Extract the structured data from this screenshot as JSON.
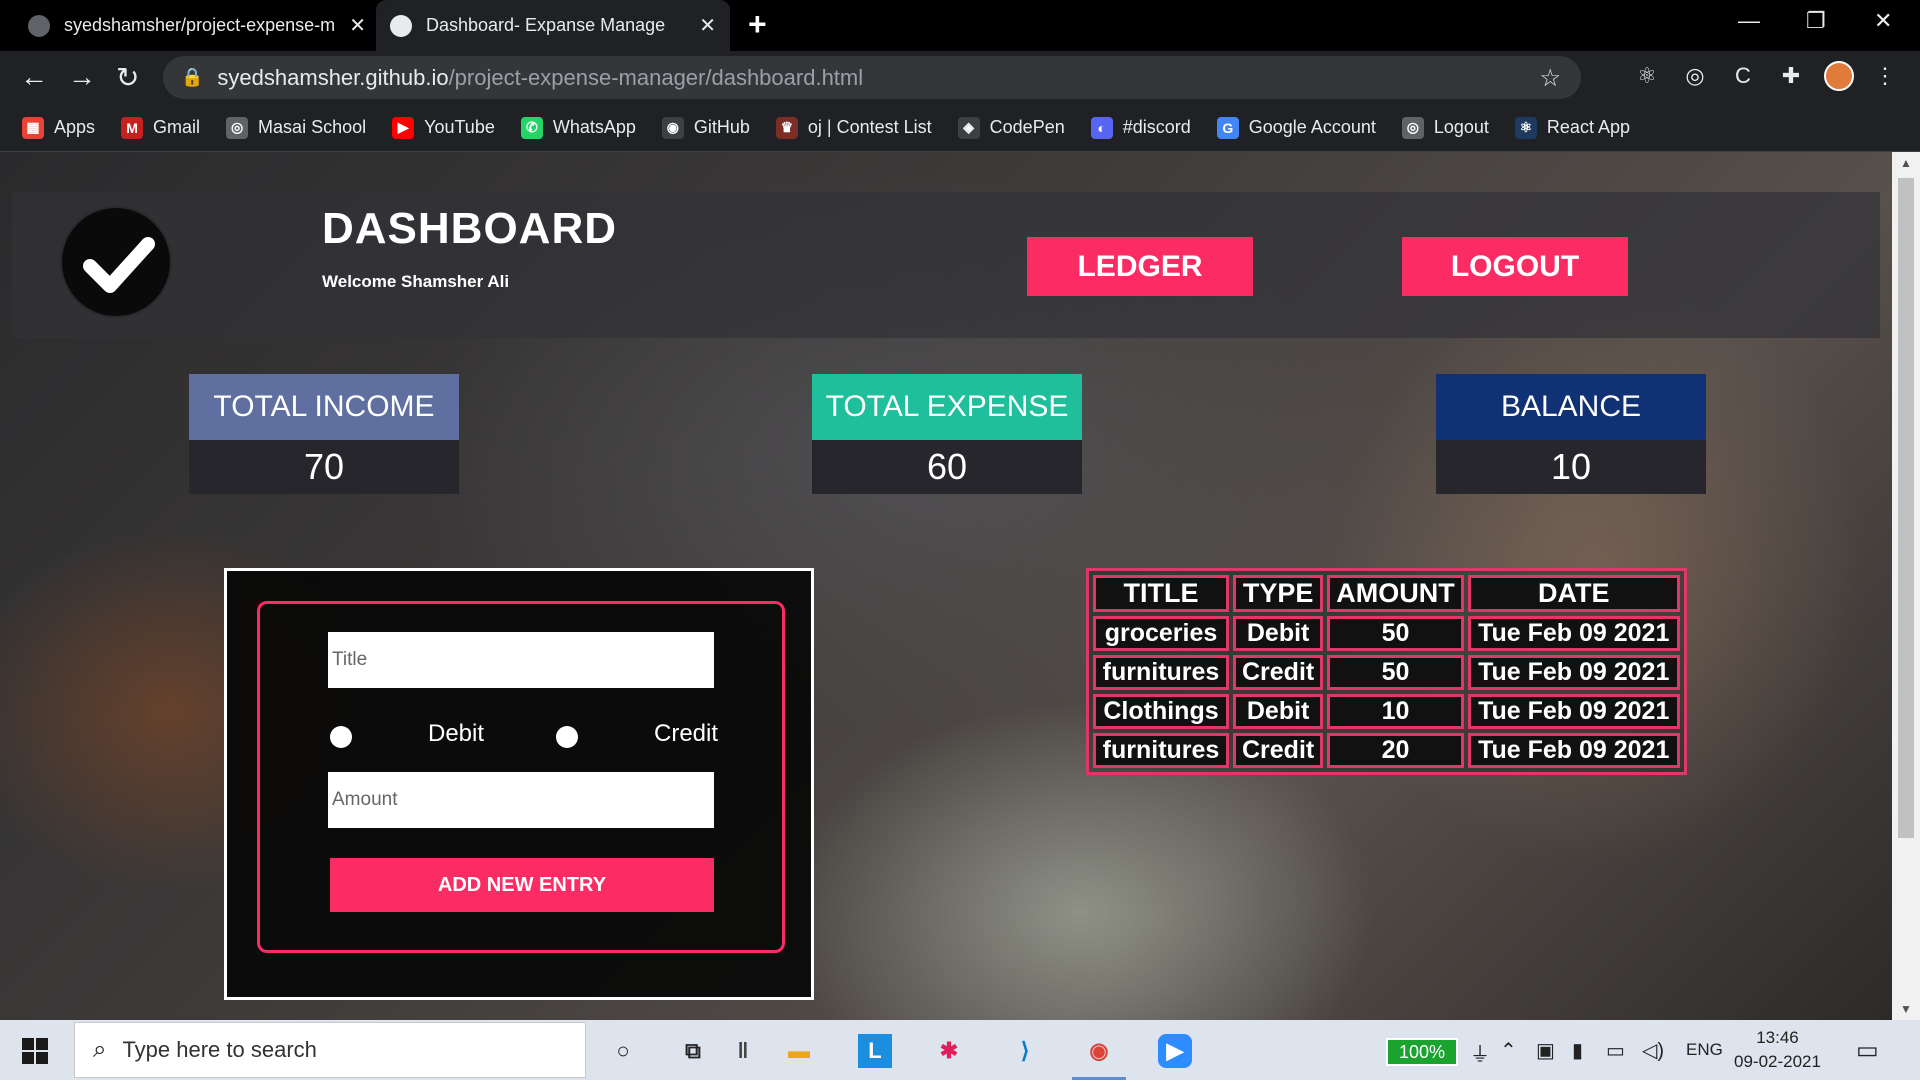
{
  "browser": {
    "tabs": [
      {
        "title": "syedshamsher/project-expense-m",
        "close": "✕"
      },
      {
        "title": "Dashboard- Expanse Manage",
        "close": "✕"
      }
    ],
    "new_tab": "+",
    "window_controls": {
      "minimize": "—",
      "restore": "❐",
      "close": "✕"
    },
    "nav": {
      "back": "←",
      "forward": "→",
      "reload": "↻"
    },
    "url_host": "syedshamsher.github.io",
    "url_path": "/project-expense-manager/dashboard.html",
    "bookmarks": [
      {
        "label": "Apps",
        "icon": "apps-grid-icon",
        "color": "#ea4335",
        "glyph": "▦"
      },
      {
        "label": "Gmail",
        "icon": "gmail-icon",
        "color": "#c5221f",
        "glyph": "M"
      },
      {
        "label": "Masai School",
        "icon": "globe-icon",
        "color": "#5f6368",
        "glyph": "◎"
      },
      {
        "label": "YouTube",
        "icon": "youtube-icon",
        "color": "#ff0000",
        "glyph": "▶"
      },
      {
        "label": "WhatsApp",
        "icon": "whatsapp-icon",
        "color": "#25d366",
        "glyph": "✆"
      },
      {
        "label": "GitHub",
        "icon": "github-icon",
        "color": "#3c4043",
        "glyph": "◉"
      },
      {
        "label": "oj | Contest List",
        "icon": "trophy-icon",
        "color": "#7b2d26",
        "glyph": "♛"
      },
      {
        "label": "CodePen",
        "icon": "codepen-icon",
        "color": "#3c4043",
        "glyph": "◈"
      },
      {
        "label": "#discord",
        "icon": "discord-icon",
        "color": "#5865f2",
        "glyph": "◐"
      },
      {
        "label": "Google Account",
        "icon": "google-icon",
        "color": "#4285f4",
        "glyph": "G"
      },
      {
        "label": "Logout",
        "icon": "globe-icon",
        "color": "#5f6368",
        "glyph": "◎"
      },
      {
        "label": "React App",
        "icon": "react-icon",
        "color": "#1e3a5f",
        "glyph": "⚛"
      }
    ]
  },
  "header": {
    "title": "DASHBOARD",
    "welcome": "Welcome Shamsher Ali",
    "ledger_button": "LEDGER",
    "logout_button": "LOGOUT"
  },
  "summary": {
    "income": {
      "label": "TOTAL INCOME",
      "value": "70"
    },
    "expense": {
      "label": "TOTAL EXPENSE",
      "value": "60"
    },
    "balance": {
      "label": "BALANCE",
      "value": "10"
    }
  },
  "form": {
    "title_placeholder": "Title",
    "debit_label": "Debit",
    "credit_label": "Credit",
    "amount_placeholder": "Amount",
    "submit_label": "ADD NEW ENTRY"
  },
  "table": {
    "headers": [
      "TITLE",
      "TYPE",
      "AMOUNT",
      "DATE"
    ],
    "rows": [
      [
        "groceries",
        "Debit",
        "50",
        "Tue Feb 09 2021"
      ],
      [
        "furnitures",
        "Credit",
        "50",
        "Tue Feb 09 2021"
      ],
      [
        "Clothings",
        "Debit",
        "10",
        "Tue Feb 09 2021"
      ],
      [
        "furnitures",
        "Credit",
        "20",
        "Tue Feb 09 2021"
      ]
    ]
  },
  "taskbar": {
    "search_placeholder": "Type here to search",
    "battery": "100%",
    "language": "ENG",
    "time": "13:46",
    "date": "09-02-2021"
  },
  "colors": {
    "accent": "#fb2c63",
    "income": "#5e6fa0",
    "expense": "#1fbf9b",
    "balance": "#103173"
  }
}
